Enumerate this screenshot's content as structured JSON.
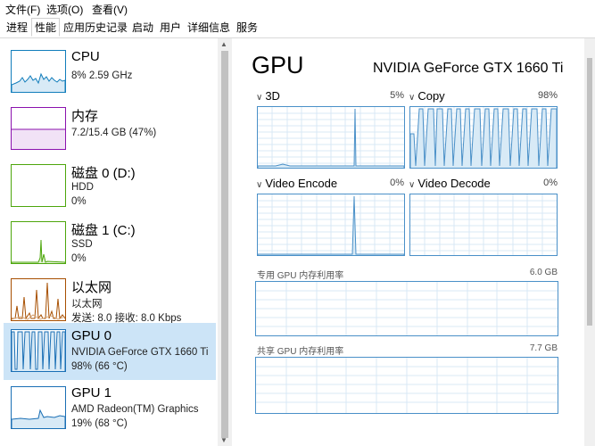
{
  "menu": [
    "文件(F)",
    "选项(O)",
    "查看(V)"
  ],
  "tabs": [
    "进程",
    "性能",
    "应用历史记录",
    "启动",
    "用户",
    "详细信息",
    "服务"
  ],
  "sidebar": [
    {
      "title": "CPU",
      "line1": "8% 2.59 GHz",
      "line2": ""
    },
    {
      "title": "内存",
      "line1": "7.2/15.4 GB (47%)",
      "line2": ""
    },
    {
      "title": "磁盘 0 (D:)",
      "line1": "HDD",
      "line2": "0%"
    },
    {
      "title": "磁盘 1 (C:)",
      "line1": "SSD",
      "line2": "0%"
    },
    {
      "title": "以太网",
      "line1": "以太网",
      "line2": "发送: 8.0 接收: 8.0 Kbps"
    },
    {
      "title": "GPU 0",
      "line1": "NVIDIA GeForce GTX 1660 Ti",
      "line2": "98% (66 °C)"
    },
    {
      "title": "GPU 1",
      "line1": "AMD Radeon(TM) Graphics",
      "line2": "19% (68 °C)"
    }
  ],
  "gpu": {
    "title": "GPU",
    "model": "NVIDIA GeForce GTX 1660 Ti",
    "engines": [
      {
        "name": "3D",
        "pct": "5%"
      },
      {
        "name": "Copy",
        "pct": "98%"
      },
      {
        "name": "Video Encode",
        "pct": "0%"
      },
      {
        "name": "Video Decode",
        "pct": "0%"
      }
    ],
    "dedicated": {
      "label": "专用 GPU 内存利用率",
      "max": "6.0 GB"
    },
    "shared": {
      "label": "共享 GPU 内存利用率",
      "max": "7.7 GB"
    }
  },
  "colors": {
    "cpu": "#117dbb",
    "memory": "#8b12ae",
    "disk": "#4da60c",
    "ethernet": "#a74f01",
    "gpu": "#1a6fb5",
    "grid": "#d9e8f5"
  }
}
